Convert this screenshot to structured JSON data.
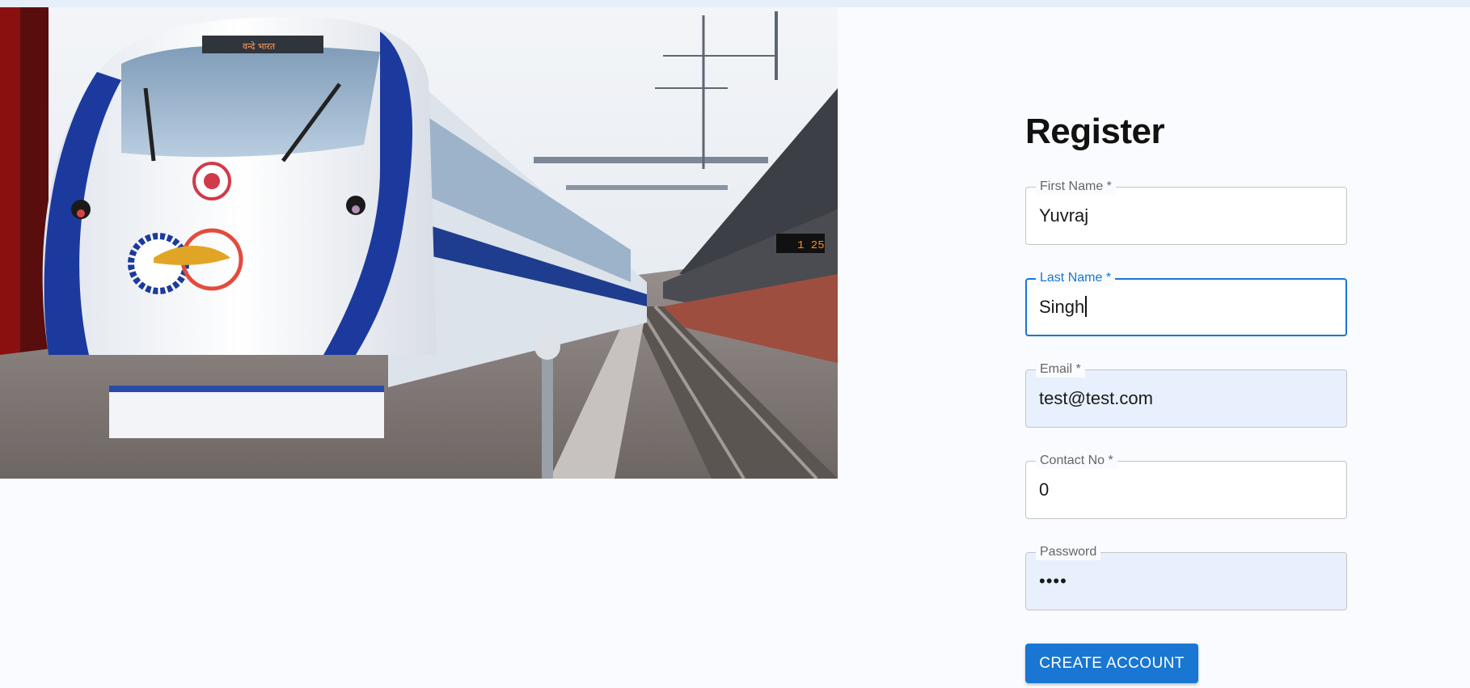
{
  "form": {
    "title": "Register",
    "fields": [
      {
        "label": "First Name *",
        "value": "Yuvraj"
      },
      {
        "label": "Last Name *",
        "value": "Singh"
      },
      {
        "label": "Email *",
        "value": "test@test.com"
      },
      {
        "label": "Contact No *",
        "value": "0"
      },
      {
        "label": "Password",
        "value": "••••"
      }
    ],
    "submit_label": "CREATE ACCOUNT"
  },
  "hero": {
    "destination_board": "वन्दे भारत",
    "platform_clock": "1 25"
  },
  "colors": {
    "accent": "#1976d2",
    "autofill_bg": "#e8f0fe",
    "page_bg": "#fafbfe"
  }
}
